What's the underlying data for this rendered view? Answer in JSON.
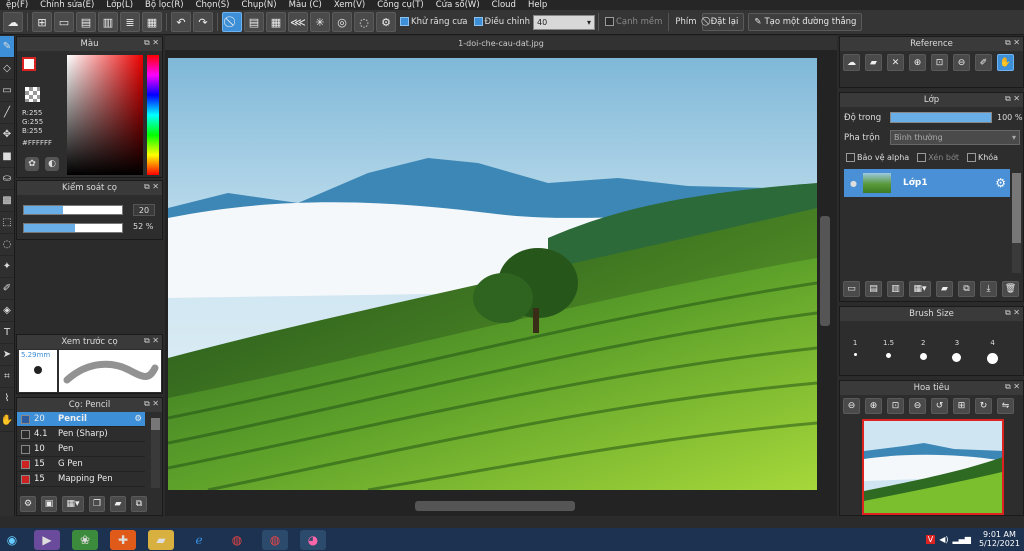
{
  "menu": [
    "ệp(F)",
    "Chỉnh sửa(E)",
    "Lớp(L)",
    "Bộ lọc(R)",
    "Chọn(S)",
    "Chụp(N)",
    "Màu (C)",
    "Xem(V)",
    "Công cụ(T)",
    "Cửa sổ(W)",
    "Cloud",
    "Help"
  ],
  "toolbar": {
    "antialias_label": "Khử răng cưa",
    "adjust_label": "Điều chỉnh",
    "adjust_value": "40",
    "smooth_label": "Cạnh mềm",
    "key_label": "Phím",
    "reset_label": "Đặt lại",
    "line_label": "Tạo một đường thẳng"
  },
  "color_panel": {
    "title": "Màu",
    "r": "R:255",
    "g": "G:255",
    "b": "B:255",
    "hex": "#FFFFFF"
  },
  "brush_control": {
    "title": "Kiểm soát cọ",
    "size_value": "20",
    "opacity_value": "52 %",
    "size_fill": 0.4,
    "opacity_fill": 0.52
  },
  "brush_preview": {
    "title": "Xem trước cọ",
    "size": "5.29mm"
  },
  "brush_list": {
    "title": "Cọ: Pencil",
    "items": [
      {
        "size": "20",
        "name": "Pencil",
        "color": "#2d5d9e",
        "selected": true
      },
      {
        "size": "4.1",
        "name": "Pen (Sharp)",
        "color": "#2a2a2a",
        "selected": false
      },
      {
        "size": "10",
        "name": "Pen",
        "color": "#2a2a2a",
        "selected": false
      },
      {
        "size": "15",
        "name": "G Pen",
        "color": "#cc2222",
        "selected": false
      },
      {
        "size": "15",
        "name": "Mapping Pen",
        "color": "#cc2222",
        "selected": false
      }
    ]
  },
  "document": {
    "filename": "1-doi-che-cau-dat.jpg"
  },
  "reference": {
    "title": "Reference"
  },
  "layer": {
    "title": "Lớp",
    "opacity_label": "Độ trong",
    "opacity_value": "100 %",
    "blend_label": "Pha trộn",
    "blend_value": "Bình thường",
    "protect_alpha": "Bảo vệ alpha",
    "clip": "Xén bớt",
    "lock": "Khóa",
    "layer_name": "Lớp1"
  },
  "brush_size": {
    "title": "Brush Size",
    "sizes": [
      "1",
      "1.5",
      "2",
      "3",
      "4"
    ]
  },
  "navigator": {
    "title": "Hoa tiêu"
  },
  "taskbar": {
    "time": "9:01 AM",
    "date": "5/12/2021"
  },
  "colors": {
    "accent": "#3d8fd8",
    "panel_bg": "#2d2d2d",
    "taskbar_bg": "#1c3250"
  }
}
